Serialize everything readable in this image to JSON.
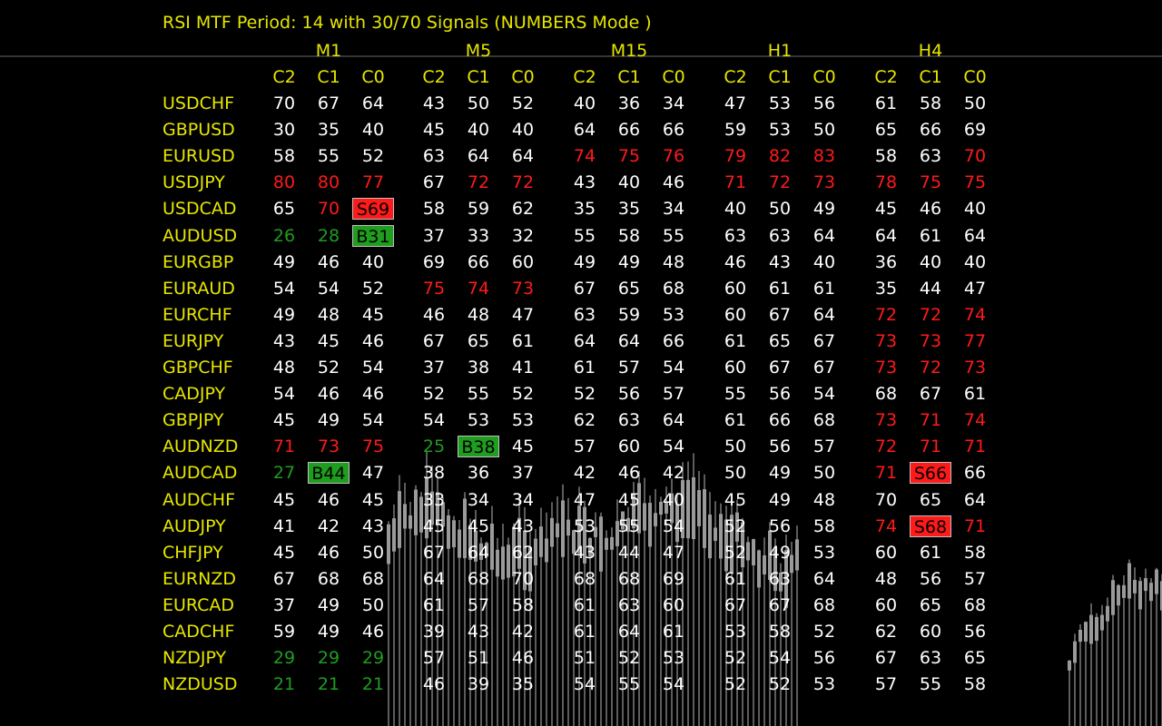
{
  "title": "RSI MTF Period: 14 with  30/70 Signals (NUMBERS Mode )",
  "timeframes": [
    "M1",
    "M5",
    "M15",
    "H1",
    "H4"
  ],
  "candle_headers": [
    "C2",
    "C1",
    "C0"
  ],
  "colors": {
    "label": "#e6e600",
    "normal": "#ffffff",
    "overbought": "#ff1a1a",
    "oversold": "#1f9d1f",
    "background": "#000000"
  },
  "rows": [
    {
      "symbol": "USDCHF",
      "cells": [
        [
          "70",
          "n"
        ],
        [
          "67",
          "n"
        ],
        [
          "64",
          "n"
        ],
        [
          "43",
          "n"
        ],
        [
          "50",
          "n"
        ],
        [
          "52",
          "n"
        ],
        [
          "40",
          "n"
        ],
        [
          "36",
          "n"
        ],
        [
          "34",
          "n"
        ],
        [
          "47",
          "n"
        ],
        [
          "53",
          "n"
        ],
        [
          "56",
          "n"
        ],
        [
          "61",
          "n"
        ],
        [
          "58",
          "n"
        ],
        [
          "50",
          "n"
        ]
      ]
    },
    {
      "symbol": "GBPUSD",
      "cells": [
        [
          "30",
          "n"
        ],
        [
          "35",
          "n"
        ],
        [
          "40",
          "n"
        ],
        [
          "45",
          "n"
        ],
        [
          "40",
          "n"
        ],
        [
          "40",
          "n"
        ],
        [
          "64",
          "n"
        ],
        [
          "66",
          "n"
        ],
        [
          "66",
          "n"
        ],
        [
          "59",
          "n"
        ],
        [
          "53",
          "n"
        ],
        [
          "50",
          "n"
        ],
        [
          "65",
          "n"
        ],
        [
          "66",
          "n"
        ],
        [
          "69",
          "n"
        ]
      ]
    },
    {
      "symbol": "EURUSD",
      "cells": [
        [
          "58",
          "n"
        ],
        [
          "55",
          "n"
        ],
        [
          "52",
          "n"
        ],
        [
          "63",
          "n"
        ],
        [
          "64",
          "n"
        ],
        [
          "64",
          "n"
        ],
        [
          "74",
          "r"
        ],
        [
          "75",
          "r"
        ],
        [
          "76",
          "r"
        ],
        [
          "79",
          "r"
        ],
        [
          "82",
          "r"
        ],
        [
          "83",
          "r"
        ],
        [
          "58",
          "n"
        ],
        [
          "63",
          "n"
        ],
        [
          "70",
          "r"
        ]
      ]
    },
    {
      "symbol": "USDJPY",
      "cells": [
        [
          "80",
          "r"
        ],
        [
          "80",
          "r"
        ],
        [
          "77",
          "r"
        ],
        [
          "67",
          "n"
        ],
        [
          "72",
          "r"
        ],
        [
          "72",
          "r"
        ],
        [
          "43",
          "n"
        ],
        [
          "40",
          "n"
        ],
        [
          "46",
          "n"
        ],
        [
          "71",
          "r"
        ],
        [
          "72",
          "r"
        ],
        [
          "73",
          "r"
        ],
        [
          "78",
          "r"
        ],
        [
          "75",
          "r"
        ],
        [
          "75",
          "r"
        ]
      ]
    },
    {
      "symbol": "USDCAD",
      "cells": [
        [
          "65",
          "n"
        ],
        [
          "70",
          "r"
        ],
        [
          "S69",
          "S"
        ],
        [
          "58",
          "n"
        ],
        [
          "59",
          "n"
        ],
        [
          "62",
          "n"
        ],
        [
          "35",
          "n"
        ],
        [
          "35",
          "n"
        ],
        [
          "34",
          "n"
        ],
        [
          "40",
          "n"
        ],
        [
          "50",
          "n"
        ],
        [
          "49",
          "n"
        ],
        [
          "45",
          "n"
        ],
        [
          "46",
          "n"
        ],
        [
          "40",
          "n"
        ]
      ]
    },
    {
      "symbol": "AUDUSD",
      "cells": [
        [
          "26",
          "g"
        ],
        [
          "28",
          "g"
        ],
        [
          "B31",
          "B"
        ],
        [
          "37",
          "n"
        ],
        [
          "33",
          "n"
        ],
        [
          "32",
          "n"
        ],
        [
          "55",
          "n"
        ],
        [
          "58",
          "n"
        ],
        [
          "55",
          "n"
        ],
        [
          "63",
          "n"
        ],
        [
          "63",
          "n"
        ],
        [
          "64",
          "n"
        ],
        [
          "64",
          "n"
        ],
        [
          "61",
          "n"
        ],
        [
          "64",
          "n"
        ]
      ]
    },
    {
      "symbol": "EURGBP",
      "cells": [
        [
          "49",
          "n"
        ],
        [
          "46",
          "n"
        ],
        [
          "40",
          "n"
        ],
        [
          "69",
          "n"
        ],
        [
          "66",
          "n"
        ],
        [
          "60",
          "n"
        ],
        [
          "49",
          "n"
        ],
        [
          "49",
          "n"
        ],
        [
          "48",
          "n"
        ],
        [
          "46",
          "n"
        ],
        [
          "43",
          "n"
        ],
        [
          "40",
          "n"
        ],
        [
          "36",
          "n"
        ],
        [
          "40",
          "n"
        ],
        [
          "40",
          "n"
        ]
      ]
    },
    {
      "symbol": "EURAUD",
      "cells": [
        [
          "54",
          "n"
        ],
        [
          "54",
          "n"
        ],
        [
          "52",
          "n"
        ],
        [
          "75",
          "r"
        ],
        [
          "74",
          "r"
        ],
        [
          "73",
          "r"
        ],
        [
          "67",
          "n"
        ],
        [
          "65",
          "n"
        ],
        [
          "68",
          "n"
        ],
        [
          "60",
          "n"
        ],
        [
          "61",
          "n"
        ],
        [
          "61",
          "n"
        ],
        [
          "35",
          "n"
        ],
        [
          "44",
          "n"
        ],
        [
          "47",
          "n"
        ]
      ]
    },
    {
      "symbol": "EURCHF",
      "cells": [
        [
          "49",
          "n"
        ],
        [
          "48",
          "n"
        ],
        [
          "45",
          "n"
        ],
        [
          "46",
          "n"
        ],
        [
          "48",
          "n"
        ],
        [
          "47",
          "n"
        ],
        [
          "63",
          "n"
        ],
        [
          "59",
          "n"
        ],
        [
          "53",
          "n"
        ],
        [
          "60",
          "n"
        ],
        [
          "67",
          "n"
        ],
        [
          "64",
          "n"
        ],
        [
          "72",
          "r"
        ],
        [
          "72",
          "r"
        ],
        [
          "74",
          "r"
        ]
      ]
    },
    {
      "symbol": "EURJPY",
      "cells": [
        [
          "43",
          "n"
        ],
        [
          "45",
          "n"
        ],
        [
          "46",
          "n"
        ],
        [
          "67",
          "n"
        ],
        [
          "65",
          "n"
        ],
        [
          "61",
          "n"
        ],
        [
          "64",
          "n"
        ],
        [
          "64",
          "n"
        ],
        [
          "66",
          "n"
        ],
        [
          "61",
          "n"
        ],
        [
          "65",
          "n"
        ],
        [
          "67",
          "n"
        ],
        [
          "73",
          "r"
        ],
        [
          "73",
          "r"
        ],
        [
          "77",
          "r"
        ]
      ]
    },
    {
      "symbol": "GBPCHF",
      "cells": [
        [
          "48",
          "n"
        ],
        [
          "52",
          "n"
        ],
        [
          "54",
          "n"
        ],
        [
          "37",
          "n"
        ],
        [
          "38",
          "n"
        ],
        [
          "41",
          "n"
        ],
        [
          "61",
          "n"
        ],
        [
          "57",
          "n"
        ],
        [
          "54",
          "n"
        ],
        [
          "60",
          "n"
        ],
        [
          "67",
          "n"
        ],
        [
          "67",
          "n"
        ],
        [
          "73",
          "r"
        ],
        [
          "72",
          "r"
        ],
        [
          "73",
          "r"
        ]
      ]
    },
    {
      "symbol": "CADJPY",
      "cells": [
        [
          "54",
          "n"
        ],
        [
          "46",
          "n"
        ],
        [
          "46",
          "n"
        ],
        [
          "52",
          "n"
        ],
        [
          "55",
          "n"
        ],
        [
          "52",
          "n"
        ],
        [
          "52",
          "n"
        ],
        [
          "56",
          "n"
        ],
        [
          "57",
          "n"
        ],
        [
          "55",
          "n"
        ],
        [
          "56",
          "n"
        ],
        [
          "54",
          "n"
        ],
        [
          "68",
          "n"
        ],
        [
          "67",
          "n"
        ],
        [
          "61",
          "n"
        ]
      ]
    },
    {
      "symbol": "GBPJPY",
      "cells": [
        [
          "45",
          "n"
        ],
        [
          "49",
          "n"
        ],
        [
          "54",
          "n"
        ],
        [
          "54",
          "n"
        ],
        [
          "53",
          "n"
        ],
        [
          "53",
          "n"
        ],
        [
          "62",
          "n"
        ],
        [
          "63",
          "n"
        ],
        [
          "64",
          "n"
        ],
        [
          "61",
          "n"
        ],
        [
          "66",
          "n"
        ],
        [
          "68",
          "n"
        ],
        [
          "73",
          "r"
        ],
        [
          "71",
          "r"
        ],
        [
          "74",
          "r"
        ]
      ]
    },
    {
      "symbol": "AUDNZD",
      "cells": [
        [
          "71",
          "r"
        ],
        [
          "73",
          "r"
        ],
        [
          "75",
          "r"
        ],
        [
          "25",
          "g"
        ],
        [
          "B38",
          "B"
        ],
        [
          "45",
          "n"
        ],
        [
          "57",
          "n"
        ],
        [
          "60",
          "n"
        ],
        [
          "54",
          "n"
        ],
        [
          "50",
          "n"
        ],
        [
          "56",
          "n"
        ],
        [
          "57",
          "n"
        ],
        [
          "72",
          "r"
        ],
        [
          "71",
          "r"
        ],
        [
          "71",
          "r"
        ]
      ]
    },
    {
      "symbol": "AUDCAD",
      "cells": [
        [
          "27",
          "g"
        ],
        [
          "B44",
          "B"
        ],
        [
          "47",
          "n"
        ],
        [
          "38",
          "n"
        ],
        [
          "36",
          "n"
        ],
        [
          "37",
          "n"
        ],
        [
          "42",
          "n"
        ],
        [
          "46",
          "n"
        ],
        [
          "42",
          "n"
        ],
        [
          "50",
          "n"
        ],
        [
          "49",
          "n"
        ],
        [
          "50",
          "n"
        ],
        [
          "71",
          "r"
        ],
        [
          "S66",
          "S"
        ],
        [
          "66",
          "n"
        ]
      ]
    },
    {
      "symbol": "AUDCHF",
      "cells": [
        [
          "45",
          "n"
        ],
        [
          "46",
          "n"
        ],
        [
          "45",
          "n"
        ],
        [
          "33",
          "n"
        ],
        [
          "34",
          "n"
        ],
        [
          "34",
          "n"
        ],
        [
          "47",
          "n"
        ],
        [
          "45",
          "n"
        ],
        [
          "40",
          "n"
        ],
        [
          "45",
          "n"
        ],
        [
          "49",
          "n"
        ],
        [
          "48",
          "n"
        ],
        [
          "70",
          "n"
        ],
        [
          "65",
          "n"
        ],
        [
          "64",
          "n"
        ]
      ]
    },
    {
      "symbol": "AUDJPY",
      "cells": [
        [
          "41",
          "n"
        ],
        [
          "42",
          "n"
        ],
        [
          "43",
          "n"
        ],
        [
          "45",
          "n"
        ],
        [
          "45",
          "n"
        ],
        [
          "43",
          "n"
        ],
        [
          "53",
          "n"
        ],
        [
          "55",
          "n"
        ],
        [
          "54",
          "n"
        ],
        [
          "52",
          "n"
        ],
        [
          "56",
          "n"
        ],
        [
          "58",
          "n"
        ],
        [
          "74",
          "r"
        ],
        [
          "S68",
          "S"
        ],
        [
          "71",
          "r"
        ]
      ]
    },
    {
      "symbol": "CHFJPY",
      "cells": [
        [
          "45",
          "n"
        ],
        [
          "46",
          "n"
        ],
        [
          "50",
          "n"
        ],
        [
          "67",
          "n"
        ],
        [
          "64",
          "n"
        ],
        [
          "62",
          "n"
        ],
        [
          "43",
          "n"
        ],
        [
          "44",
          "n"
        ],
        [
          "47",
          "n"
        ],
        [
          "52",
          "n"
        ],
        [
          "49",
          "n"
        ],
        [
          "53",
          "n"
        ],
        [
          "60",
          "n"
        ],
        [
          "61",
          "n"
        ],
        [
          "58",
          "n"
        ]
      ]
    },
    {
      "symbol": "EURNZD",
      "cells": [
        [
          "67",
          "n"
        ],
        [
          "68",
          "n"
        ],
        [
          "68",
          "n"
        ],
        [
          "64",
          "n"
        ],
        [
          "68",
          "n"
        ],
        [
          "70",
          "n"
        ],
        [
          "68",
          "n"
        ],
        [
          "68",
          "n"
        ],
        [
          "69",
          "n"
        ],
        [
          "61",
          "n"
        ],
        [
          "63",
          "n"
        ],
        [
          "64",
          "n"
        ],
        [
          "48",
          "n"
        ],
        [
          "56",
          "n"
        ],
        [
          "57",
          "n"
        ]
      ]
    },
    {
      "symbol": "EURCAD",
      "cells": [
        [
          "37",
          "n"
        ],
        [
          "49",
          "n"
        ],
        [
          "50",
          "n"
        ],
        [
          "61",
          "n"
        ],
        [
          "57",
          "n"
        ],
        [
          "58",
          "n"
        ],
        [
          "61",
          "n"
        ],
        [
          "63",
          "n"
        ],
        [
          "60",
          "n"
        ],
        [
          "67",
          "n"
        ],
        [
          "67",
          "n"
        ],
        [
          "68",
          "n"
        ],
        [
          "60",
          "n"
        ],
        [
          "65",
          "n"
        ],
        [
          "68",
          "n"
        ]
      ]
    },
    {
      "symbol": "CADCHF",
      "cells": [
        [
          "59",
          "n"
        ],
        [
          "49",
          "n"
        ],
        [
          "46",
          "n"
        ],
        [
          "39",
          "n"
        ],
        [
          "43",
          "n"
        ],
        [
          "42",
          "n"
        ],
        [
          "61",
          "n"
        ],
        [
          "64",
          "n"
        ],
        [
          "61",
          "n"
        ],
        [
          "53",
          "n"
        ],
        [
          "58",
          "n"
        ],
        [
          "52",
          "n"
        ],
        [
          "62",
          "n"
        ],
        [
          "60",
          "n"
        ],
        [
          "56",
          "n"
        ]
      ]
    },
    {
      "symbol": "NZDJPY",
      "cells": [
        [
          "29",
          "g"
        ],
        [
          "29",
          "g"
        ],
        [
          "29",
          "g"
        ],
        [
          "57",
          "n"
        ],
        [
          "51",
          "n"
        ],
        [
          "46",
          "n"
        ],
        [
          "51",
          "n"
        ],
        [
          "52",
          "n"
        ],
        [
          "53",
          "n"
        ],
        [
          "52",
          "n"
        ],
        [
          "54",
          "n"
        ],
        [
          "56",
          "n"
        ],
        [
          "67",
          "n"
        ],
        [
          "63",
          "n"
        ],
        [
          "65",
          "n"
        ]
      ]
    },
    {
      "symbol": "NZDUSD",
      "cells": [
        [
          "21",
          "g"
        ],
        [
          "21",
          "g"
        ],
        [
          "21",
          "g"
        ],
        [
          "46",
          "n"
        ],
        [
          "39",
          "n"
        ],
        [
          "35",
          "n"
        ],
        [
          "54",
          "n"
        ],
        [
          "55",
          "n"
        ],
        [
          "54",
          "n"
        ],
        [
          "52",
          "n"
        ],
        [
          "52",
          "n"
        ],
        [
          "53",
          "n"
        ],
        [
          "57",
          "n"
        ],
        [
          "55",
          "n"
        ],
        [
          "58",
          "n"
        ]
      ]
    }
  ]
}
